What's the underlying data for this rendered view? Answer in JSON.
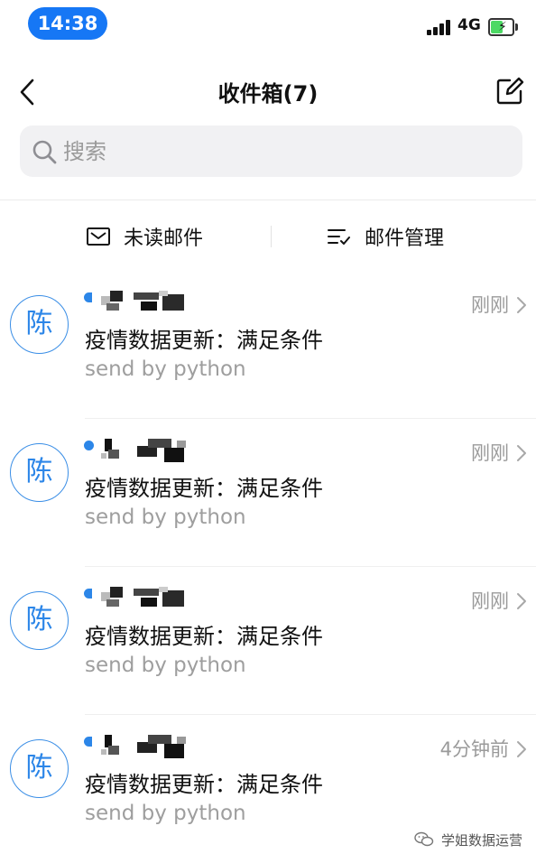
{
  "status_bar": {
    "time": "14:38",
    "network": "4G"
  },
  "header": {
    "title": "收件箱(7)"
  },
  "search": {
    "placeholder": "搜索"
  },
  "filters": {
    "unread_label": "未读邮件",
    "manage_label": "邮件管理"
  },
  "mails": [
    {
      "avatar": "陈",
      "time": "刚刚",
      "subject": "疫情数据更新：满足条件",
      "preview": "send by python"
    },
    {
      "avatar": "陈",
      "time": "刚刚",
      "subject": "疫情数据更新：满足条件",
      "preview": "send by python"
    },
    {
      "avatar": "陈",
      "time": "刚刚",
      "subject": "疫情数据更新：满足条件",
      "preview": "send by python"
    },
    {
      "avatar": "陈",
      "time": "4分钟前",
      "subject": "疫情数据更新：满足条件",
      "preview": "send by python"
    }
  ],
  "watermark": {
    "text": "学姐数据运营"
  },
  "colors": {
    "accent": "#2c86e8",
    "time_pill": "#1677f5",
    "battery": "#4cd964",
    "secondary_text": "#9a9a9a"
  },
  "icons": {
    "back": "chevron-left-icon",
    "compose": "compose-icon",
    "search": "search-icon",
    "unread": "envelope-icon",
    "manage": "checklist-icon",
    "row": "chevron-right-icon"
  }
}
